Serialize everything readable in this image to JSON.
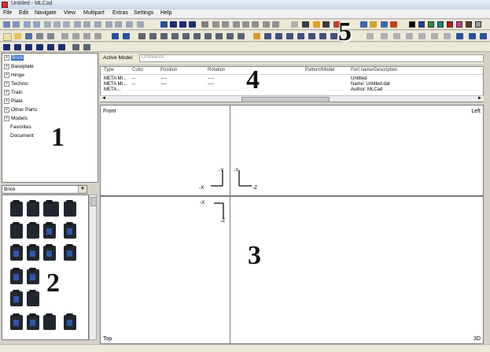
{
  "window": {
    "title": "Untitled - MLCad"
  },
  "menu": [
    "File",
    "Edit",
    "Navigate",
    "View",
    "Multipart",
    "Extras",
    "Settings",
    "Help"
  ],
  "palette_colors": [
    "#000000",
    "#1f3f9f",
    "#2c8f3a",
    "#0b8a8a",
    "#b71b1b",
    "#c43a8e",
    "#6b3a1b",
    "#9c9c9c",
    "#6a6a6a"
  ],
  "tree": {
    "items": [
      "Brick",
      "Baseplate",
      "Hinge",
      "Technic",
      "Train",
      "Plate",
      "Other Parts",
      "Models",
      "Favorites",
      "Document"
    ],
    "expandable": [
      true,
      true,
      true,
      true,
      true,
      true,
      true,
      true,
      false,
      false
    ]
  },
  "parts_panel": {
    "selected_category": "Brick"
  },
  "model": {
    "active_model_label": "Active Model",
    "active_model_value": "Untitled.ldr",
    "columns": [
      "Type",
      "Color",
      "Position",
      "Rotation",
      "Pattern/Model",
      "Part name/Description"
    ],
    "rows": [
      {
        "type": "META Mi...",
        "color": "--",
        "position": "----",
        "rotation": "----",
        "pattern": "",
        "description": "Untitled"
      },
      {
        "type": "META Mi...",
        "color": "--",
        "position": "----",
        "rotation": "----",
        "pattern": "",
        "description": "Name: Untitled.dat"
      },
      {
        "type": "META...",
        "color": "",
        "position": "",
        "rotation": "",
        "pattern": "",
        "description": "Author: MLCad"
      }
    ]
  },
  "viewports": {
    "front": "Front",
    "left": "Left",
    "top": "Top",
    "three_d": "3D"
  },
  "axes": {
    "y": "-Y",
    "x": "-X",
    "z": "-Z"
  },
  "annotations": [
    "1",
    "2",
    "3",
    "4",
    "5"
  ]
}
